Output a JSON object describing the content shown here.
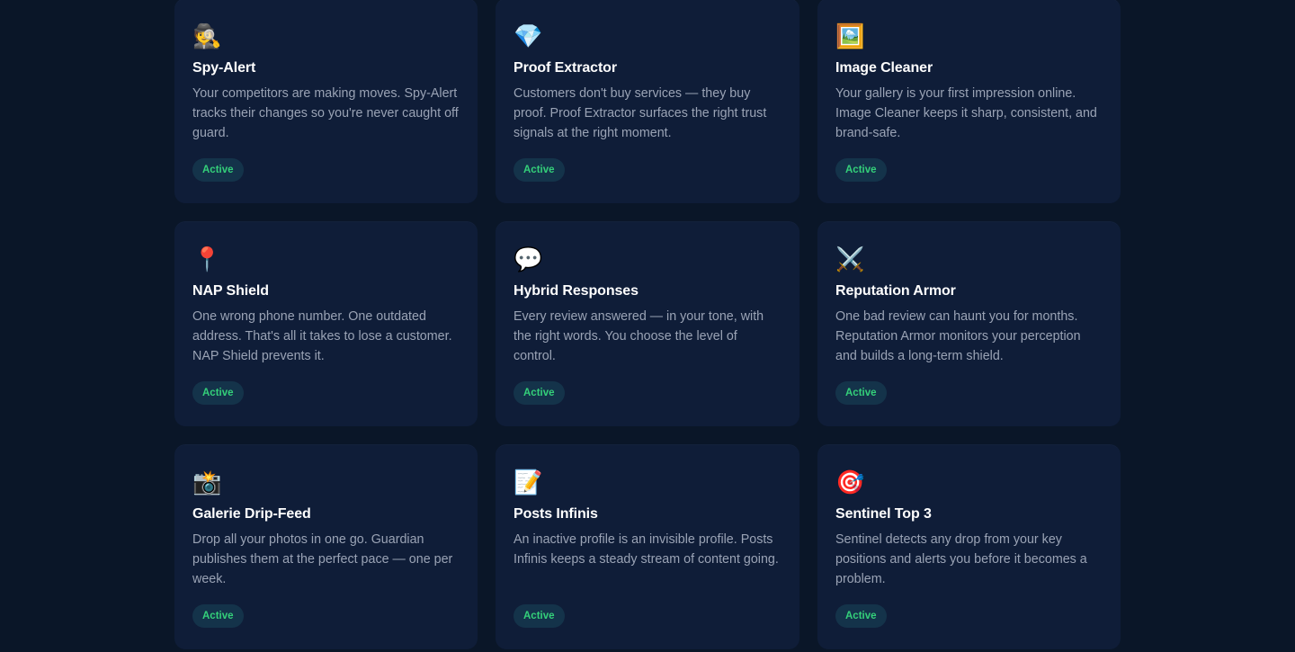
{
  "cards": [
    {
      "icon": "🕵️",
      "icon_name": "detective-icon",
      "title": "Spy-Alert",
      "description": "Your competitors are making moves. Spy-Alert tracks their changes so you're never caught off guard.",
      "status": "Active"
    },
    {
      "icon": "💎",
      "icon_name": "diamond-icon",
      "title": "Proof Extractor",
      "description": "Customers don't buy services — they buy proof. Proof Extractor surfaces the right trust signals at the right moment.",
      "status": "Active"
    },
    {
      "icon": "🖼️",
      "icon_name": "framed-picture-icon",
      "title": "Image Cleaner",
      "description": "Your gallery is your first impression online. Image Cleaner keeps it sharp, consistent, and brand-safe.",
      "status": "Active"
    },
    {
      "icon": "📍",
      "icon_name": "map-pin-icon",
      "title": "NAP Shield",
      "description": "One wrong phone number. One outdated address. That's all it takes to lose a customer. NAP Shield prevents it.",
      "status": "Active"
    },
    {
      "icon": "💬",
      "icon_name": "speech-bubble-icon",
      "title": "Hybrid Responses",
      "description": "Every review answered — in your tone, with the right words. You choose the level of control.",
      "status": "Active"
    },
    {
      "icon": "⚔️",
      "icon_name": "crossed-swords-icon",
      "title": "Reputation Armor",
      "description": "One bad review can haunt you for months. Reputation Armor monitors your perception and builds a long-term shield.",
      "status": "Active"
    },
    {
      "icon": "📸",
      "icon_name": "camera-flash-icon",
      "title": "Galerie Drip-Feed",
      "description": "Drop all your photos in one go. Guardian publishes them at the perfect pace — one per week.",
      "status": "Active"
    },
    {
      "icon": "📝",
      "icon_name": "memo-icon",
      "title": "Posts Infinis",
      "description": "An inactive profile is an invisible profile. Posts Infinis keeps a steady stream of content going.",
      "status": "Active"
    },
    {
      "icon": "🎯",
      "icon_name": "target-icon",
      "title": "Sentinel Top 3",
      "description": "Sentinel detects any drop from your key positions and alerts you before it becomes a problem.",
      "status": "Active"
    }
  ],
  "colors": {
    "page_background": "#0a1628",
    "card_background": "#0f1d38",
    "title": "#ffffff",
    "description": "#9aa3b5",
    "badge_background": "#14334a",
    "badge_text": "#34d07a"
  }
}
